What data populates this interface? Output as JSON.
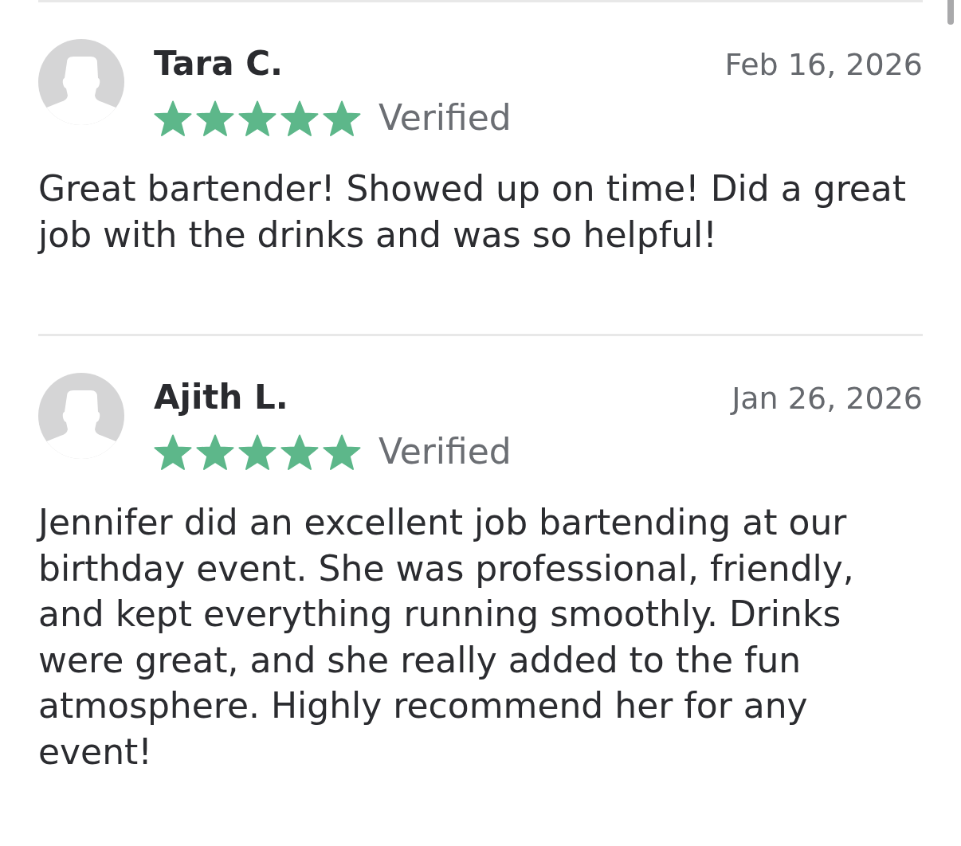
{
  "reviews": [
    {
      "name": "Tara C.",
      "date": "Feb 16, 2026",
      "stars": 5,
      "badge": "Verified",
      "text": "Great bartender! Showed up on time! Did a great job with the drinks and was so helpful!"
    },
    {
      "name": "Ajith L.",
      "date": "Jan 26, 2026",
      "stars": 5,
      "badge": "Verified",
      "text": "Jennifer did an excellent job bartending at our birthday event. She was professional, friendly, and kept everything running smoothly. Drinks were great, and she really added to the fun atmosphere. Highly recommend her for any event!"
    }
  ]
}
